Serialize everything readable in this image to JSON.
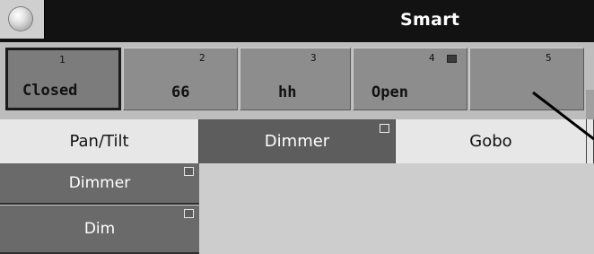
{
  "header": {
    "title": "Smart"
  },
  "presets": [
    {
      "number": "1",
      "label": "Closed",
      "active": true
    },
    {
      "number": "2",
      "label": "66",
      "active": false
    },
    {
      "number": "3",
      "label": "hh",
      "active": false
    },
    {
      "number": "4",
      "label": "Open",
      "active": false,
      "marked": true
    },
    {
      "number": "5",
      "label": "",
      "active": false
    }
  ],
  "tabs": [
    {
      "label": "Pan/Tilt",
      "active": false
    },
    {
      "label": "Dimmer",
      "active": true
    },
    {
      "label": "Gobo",
      "active": false
    }
  ],
  "sidebar": {
    "items": [
      {
        "label": "Dimmer"
      },
      {
        "label": "Dim"
      }
    ]
  },
  "colors": {
    "titlebar": "#121212",
    "active_tab": "#5d5d5d",
    "preset_button": "#8d8d8d"
  }
}
